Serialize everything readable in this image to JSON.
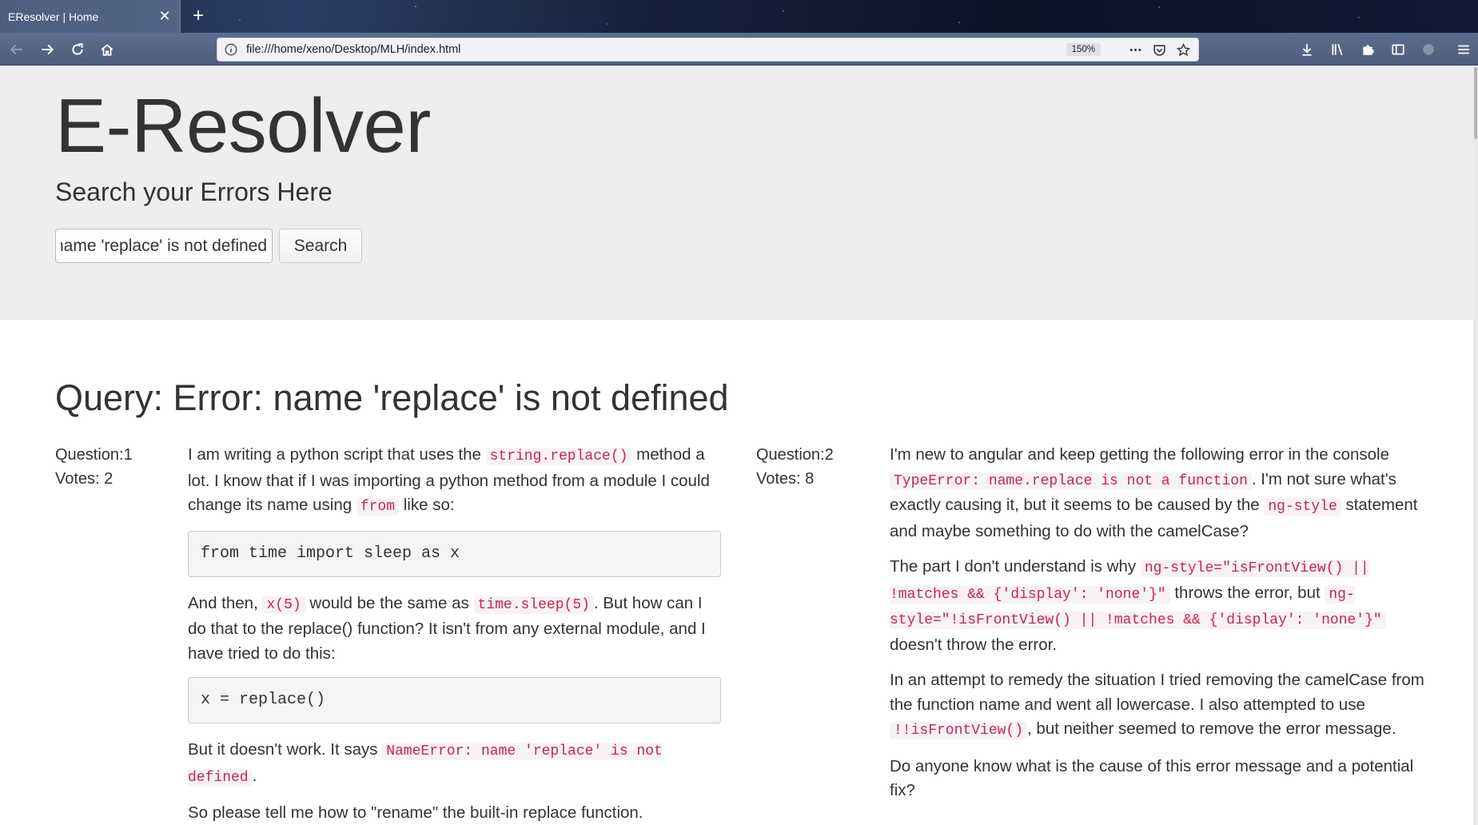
{
  "browser": {
    "tab_title": "EResolver | Home",
    "url": "file:///home/xeno/Desktop/MLH/index.html",
    "zoom": "150%"
  },
  "hero": {
    "title": "E-Resolver",
    "subtitle": "Search your Errors Here",
    "search_value": "name 'replace' is not defined",
    "search_button": "Search"
  },
  "query": {
    "heading": "Query: Error: name 'replace' is not defined"
  },
  "questions": [
    {
      "question_label": "Question:1",
      "votes_label": "Votes: 2",
      "p1_a": "I am writing a python script that uses the ",
      "p1_code1": "string.replace()",
      "p1_b": " method a lot. I know that if I was importing a python method from a module I could change its name using ",
      "p1_code2": "from",
      "p1_c": " like so:",
      "pre1": "from time import sleep as x",
      "p2_a": "And then, ",
      "p2_code1": "x(5)",
      "p2_b": " would be the same as ",
      "p2_code2": "time.sleep(5)",
      "p2_c": ". But how can I do that to the replace() function? It isn't from any external module, and I have tried to do this:",
      "pre2": "x = replace()",
      "p3_a": "But it doesn't work. It says ",
      "p3_code1": "NameError: name 'replace' is not defined",
      "p3_b": ".",
      "p4": "So please tell me how to \"rename\" the built-in replace function."
    },
    {
      "question_label": "Question:2",
      "votes_label": "Votes: 8",
      "p1_a": "I'm new to angular and keep getting the following error in the console ",
      "p1_code1": "TypeError: name.replace is not a function",
      "p1_b": ". I'm not sure what's exactly causing it, but it seems to be caused by the ",
      "p1_code2": "ng-style",
      "p1_c": " statement and maybe something to do with the camelCase?",
      "p2_a": "The part I don't understand is why ",
      "p2_code1": "ng-style=\"isFrontView() || !matches && {'display': 'none'}\"",
      "p2_b": " throws the error, but ",
      "p2_code2": "ng-style=\"!isFrontView() || !matches && {'display': 'none'}\"",
      "p2_c": " doesn't throw the error.",
      "p3_a": "In an attempt to remedy the situation I tried removing the camelCase from the function name and went all lowercase. I also attempted to use ",
      "p3_code1": "!!isFrontView()",
      "p3_b": ", but neither seemed to remove the error message.",
      "p4": "Do anyone know what is the cause of this error message and a potential fix?"
    }
  ]
}
